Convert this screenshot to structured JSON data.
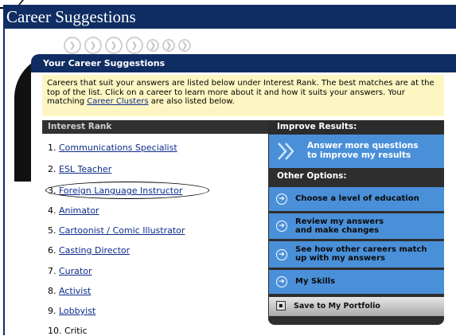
{
  "page": {
    "title": "Career Suggestions"
  },
  "panel": {
    "header": "Your Career Suggestions",
    "intro_pre": "Careers that suit your answers are listed below under Interest Rank. The best matches are at the top of the list. Click on a career to learn more about it and how it suits your answers.  Your matching ",
    "intro_link": "Career Clusters",
    "intro_post": " are also listed below."
  },
  "rank": {
    "header": "Interest Rank",
    "items": [
      {
        "num": "1.",
        "label": "Communications Specialist",
        "link": true
      },
      {
        "num": "2.",
        "label": "ESL Teacher",
        "link": true
      },
      {
        "num": "3.",
        "label": "Foreign Language Instructor",
        "link": true
      },
      {
        "num": "4.",
        "label": "Animator",
        "link": true
      },
      {
        "num": "5.",
        "label": "Cartoonist / Comic Illustrator",
        "link": true
      },
      {
        "num": "6.",
        "label": "Casting Director",
        "link": true
      },
      {
        "num": "7.",
        "label": "Curator",
        "link": true
      },
      {
        "num": "8.",
        "label": "Activist",
        "link": true
      },
      {
        "num": "9.",
        "label": "Lobbyist",
        "link": true
      },
      {
        "num": "10.",
        "label": "Critic",
        "link": false
      }
    ]
  },
  "improve": {
    "header": "Improve Results:",
    "button_line1": "Answer more questions",
    "button_line2": "to improve my results"
  },
  "other": {
    "header": "Other Options:",
    "options": [
      {
        "line1": "Choose a level of education",
        "line2": ""
      },
      {
        "line1": "Review my answers",
        "line2": "and make changes"
      },
      {
        "line1": "See how other careers match",
        "line2": "up with my answers"
      },
      {
        "line1": "My Skills",
        "line2": ""
      }
    ],
    "save_label": "Save to My Portfolio"
  },
  "colors": {
    "navy": "#0f2d63",
    "blue_button": "#4a90d9",
    "intro_bg": "#fdf6c2",
    "link": "#0d2b8a"
  }
}
